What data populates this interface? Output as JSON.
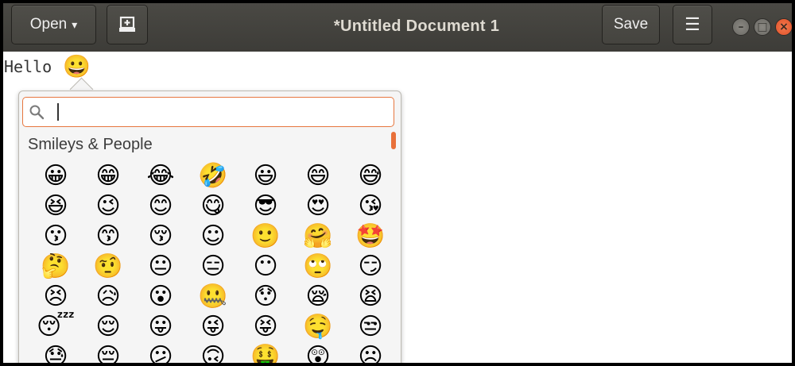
{
  "window": {
    "title": "*Untitled Document 1",
    "open_label": "Open",
    "open_caret": "▾",
    "newtab_glyph": "⊞",
    "save_label": "Save",
    "menu_glyph": "☰",
    "minimize_glyph": "–",
    "maximize_glyph": "□",
    "close_glyph": "×"
  },
  "editor": {
    "text": "Hello",
    "inserted_emoji": "😀"
  },
  "emoji_chooser": {
    "search_value": "",
    "section": "Smileys & People",
    "accent_color": "#e8703a",
    "emojis": [
      "😀",
      "😁",
      "😂",
      "🤣",
      "😃",
      "😄",
      "😅",
      "😆",
      "😉",
      "😊",
      "😋",
      "😎",
      "😍",
      "😘",
      "😗",
      "😙",
      "😚",
      "☺",
      "🙂",
      "🤗",
      "🤩",
      "🤔",
      "🤨",
      "😐",
      "😑",
      "😶",
      "🙄",
      "😏",
      "😣",
      "😥",
      "😮",
      "🤐",
      "😯",
      "😪",
      "😫",
      "😴",
      "😌",
      "😛",
      "😜",
      "😝",
      "🤤",
      "😒",
      "😓",
      "😔",
      "😕",
      "🙃",
      "🤑",
      "😲",
      "☹"
    ]
  }
}
